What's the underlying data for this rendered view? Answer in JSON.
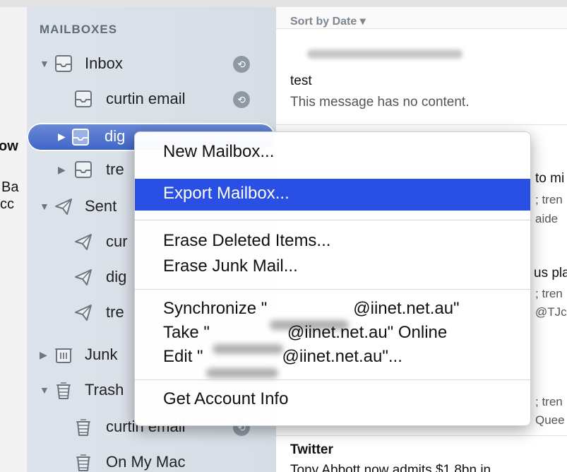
{
  "sidebar": {
    "header": "MAILBOXES",
    "items": [
      {
        "label": "Inbox",
        "disclosure": "▼",
        "icon": "inbox-tray-icon"
      },
      {
        "label": "curtin email",
        "icon": "inbox-tray-icon"
      },
      {
        "label": "dig",
        "disclosure": "▶",
        "icon": "inbox-tray-icon"
      },
      {
        "label": "tre",
        "disclosure": "▶",
        "icon": "inbox-tray-icon"
      },
      {
        "label": "Sent",
        "disclosure": "▼",
        "icon": "paper-plane-icon"
      },
      {
        "label": "cur",
        "icon": "paper-plane-icon"
      },
      {
        "label": "dig",
        "icon": "paper-plane-icon"
      },
      {
        "label": "tre",
        "icon": "paper-plane-icon"
      },
      {
        "label": "Junk",
        "disclosure": "▶",
        "icon": "junk-bin-icon"
      },
      {
        "label": "Trash",
        "disclosure": "▼",
        "icon": "trash-can-icon"
      },
      {
        "label": "curtin email",
        "icon": "trash-can-icon"
      },
      {
        "label": "On My Mac",
        "icon": "trash-can-icon"
      }
    ]
  },
  "left_fragments": [
    "ow",
    "Ba",
    "cc"
  ],
  "message_list": {
    "sort_label": "Sort by Date ▾",
    "messages": [
      {
        "subject": "test",
        "preview": "This message has no content."
      },
      {
        "sender": "Twitter",
        "subject": "Tony Abbott now admits $1.8bn in"
      }
    ],
    "partial_right_text": [
      "to mi",
      "; tren",
      "aide",
      "us pla",
      "; tren",
      "@TJc",
      "; tren",
      "Quee"
    ]
  },
  "context_menu": {
    "items": [
      {
        "label": "New Mailbox..."
      },
      {
        "label": "Export Mailbox...",
        "highlighted": true
      },
      {
        "label": "Erase Deleted Items..."
      },
      {
        "label": "Erase Junk Mail..."
      },
      {
        "label_prefix": "Synchronize \"",
        "label_suffix": "@iinet.net.au\""
      },
      {
        "label_prefix": "Take \"",
        "label_suffix": "@iinet.net.au\" Online"
      },
      {
        "label_prefix": "Edit \"",
        "label_suffix": "@iinet.net.au\"..."
      },
      {
        "label": "Get Account Info"
      }
    ]
  },
  "colors": {
    "highlight": "#2a4fe4",
    "selection": "#3d64c6"
  }
}
